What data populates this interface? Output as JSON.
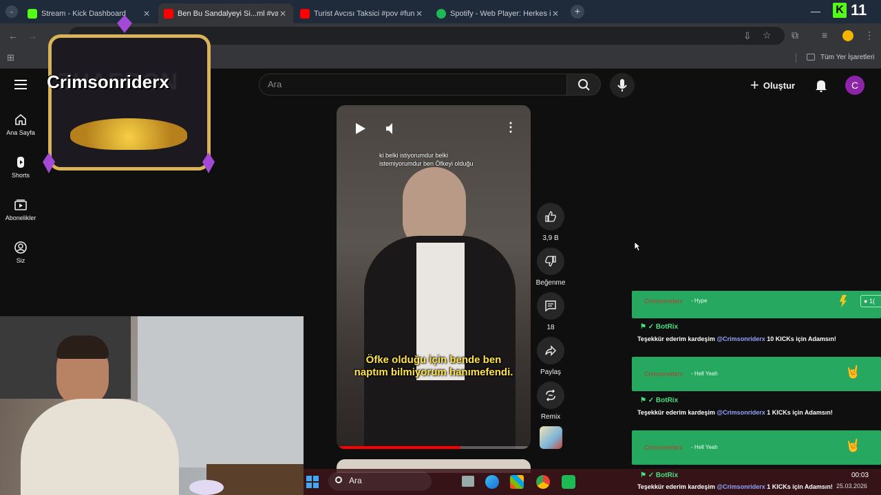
{
  "tabs": [
    {
      "title": "Stream - Kick Dashboard",
      "color": "#53fc18"
    },
    {
      "title": "Ben Bu Sandalyeyi Si...ml #vart",
      "color": "#ff0000"
    },
    {
      "title": "Turist Avcısı Taksici #pov #funn",
      "color": "#ff0000"
    },
    {
      "title": "Spotify - Web Player: Herkes iç",
      "color": "#1db954"
    }
  ],
  "window": {
    "kick_badge": "11"
  },
  "bookmarks": {
    "all_label": "Tüm Yer İşaretleri"
  },
  "youtube": {
    "search_placeholder": "Ara",
    "create_label": "Oluştur",
    "avatar_letter": "C",
    "sidebar": [
      {
        "label": "Ana Sayfa",
        "icon": "home-icon"
      },
      {
        "label": "Shorts",
        "icon": "shorts-icon"
      },
      {
        "label": "Abonelikler",
        "icon": "subscriptions-icon"
      },
      {
        "label": "Siz",
        "icon": "you-icon"
      }
    ],
    "short": {
      "caption_top": "ki belki istiyorumdur belki istemiyorumdur ben Öfkeyi olduğu",
      "subtitle": "Öfke olduğu için bende ben naptım bilmiyorum hanımefendi.",
      "progress": 0.64
    },
    "actions": {
      "like_count": "3,9 B",
      "dislike_label": "Beğenme",
      "comment_count": "18",
      "share_label": "Paylaş",
      "remix_label": "Remix"
    }
  },
  "overlay": {
    "streamer_name": "Crimsonriderx",
    "bg_text": "ZHAERON",
    "chat": [
      {
        "user": "Crimsonriderx",
        "type": "- Hype",
        "bot": "BotRix",
        "msg_pre": "Teşekkür ederim kardeşim ",
        "mention": "@Crimsonriderx",
        "msg_post": " 10 KICKs için Adamsın!",
        "badge": "1("
      },
      {
        "user": "Crimsonriderx",
        "type": "- Hell Yeah",
        "bot": "BotRix",
        "msg_pre": "Teşekkür ederim kardeşim ",
        "mention": "@Crimsonriderx",
        "msg_post": " 1 KICKs için Adamsın!",
        "badge": ""
      },
      {
        "user": "Crimsonriderx",
        "type": "- Hell Yeah",
        "bot": "BotRix",
        "msg_pre": "Teşekkür ederim kardeşim ",
        "mention": "@Crimsonriderx",
        "msg_post": " 1 KICKs için Adamsın!",
        "badge": ""
      }
    ]
  },
  "taskbar": {
    "search_label": "Ara",
    "time": "00:03",
    "date": "25.03.2026"
  }
}
